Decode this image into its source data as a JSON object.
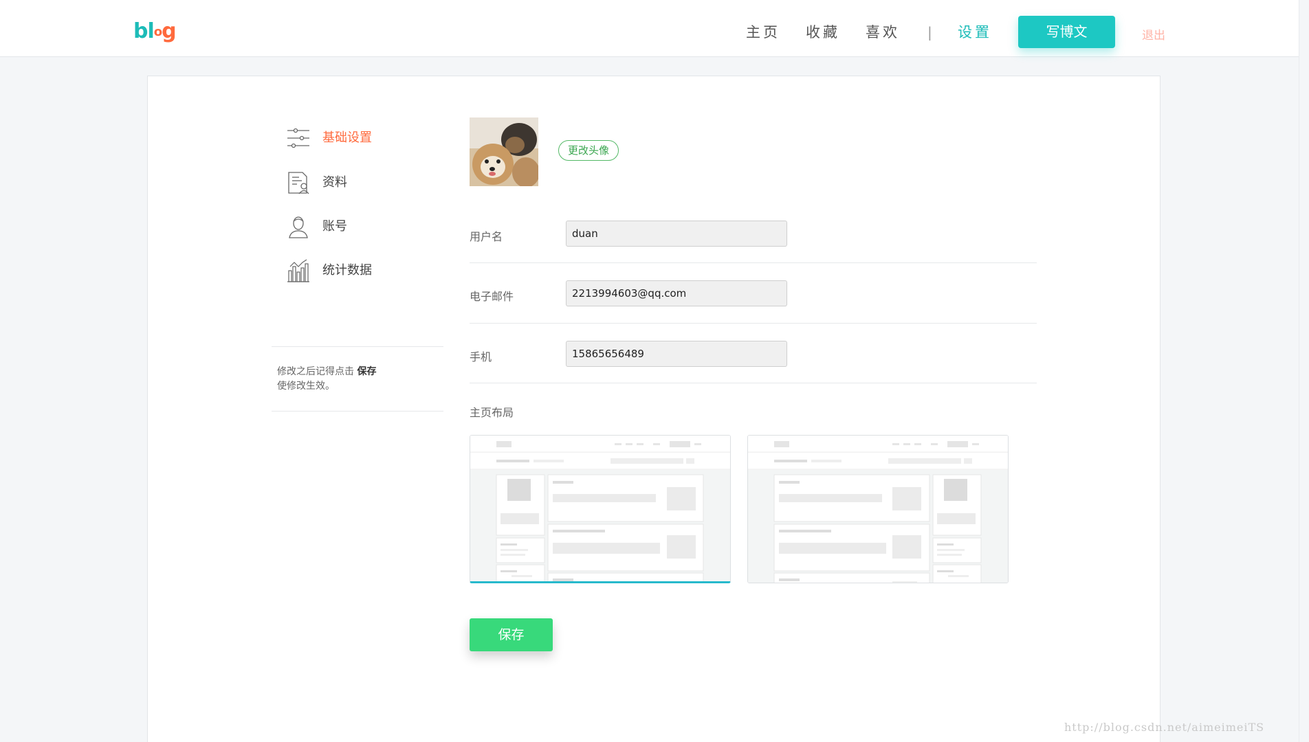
{
  "header": {
    "logo": {
      "part1": "bl",
      "part2": "o",
      "part3": "g"
    },
    "nav": {
      "home": "主页",
      "favorites": "收藏",
      "likes": "喜欢",
      "separator": "|",
      "settings": "设置"
    },
    "write_button": "写博文",
    "logout": "退出"
  },
  "sidebar": {
    "items": [
      {
        "label": "基础设置",
        "icon": "sliders-icon",
        "active": true
      },
      {
        "label": "资料",
        "icon": "profile-doc-icon",
        "active": false
      },
      {
        "label": "账号",
        "icon": "user-icon",
        "active": false
      },
      {
        "label": "统计数据",
        "icon": "chart-icon",
        "active": false
      }
    ],
    "tip_prefix": "修改之后记得点击 ",
    "tip_bold": "保存",
    "tip_suffix": "使修改生效。"
  },
  "profile": {
    "change_avatar": "更改头像",
    "fields": {
      "username": {
        "label": "用户名",
        "value": "duan"
      },
      "email": {
        "label": "电子邮件",
        "value": "2213994603@qq.com"
      },
      "phone": {
        "label": "手机",
        "value": "15865656489"
      }
    },
    "layout_label": "主页布局",
    "layouts": [
      {
        "name": "sidebar-left",
        "selected": true
      },
      {
        "name": "sidebar-right",
        "selected": false
      }
    ],
    "save": "保存"
  },
  "colors": {
    "accent": "#1dc8c3",
    "active": "#ff6a3d",
    "save": "#38d97b",
    "logout": "#ffb3a6"
  },
  "watermark": "http://blog.csdn.net/aimeimeiTS"
}
